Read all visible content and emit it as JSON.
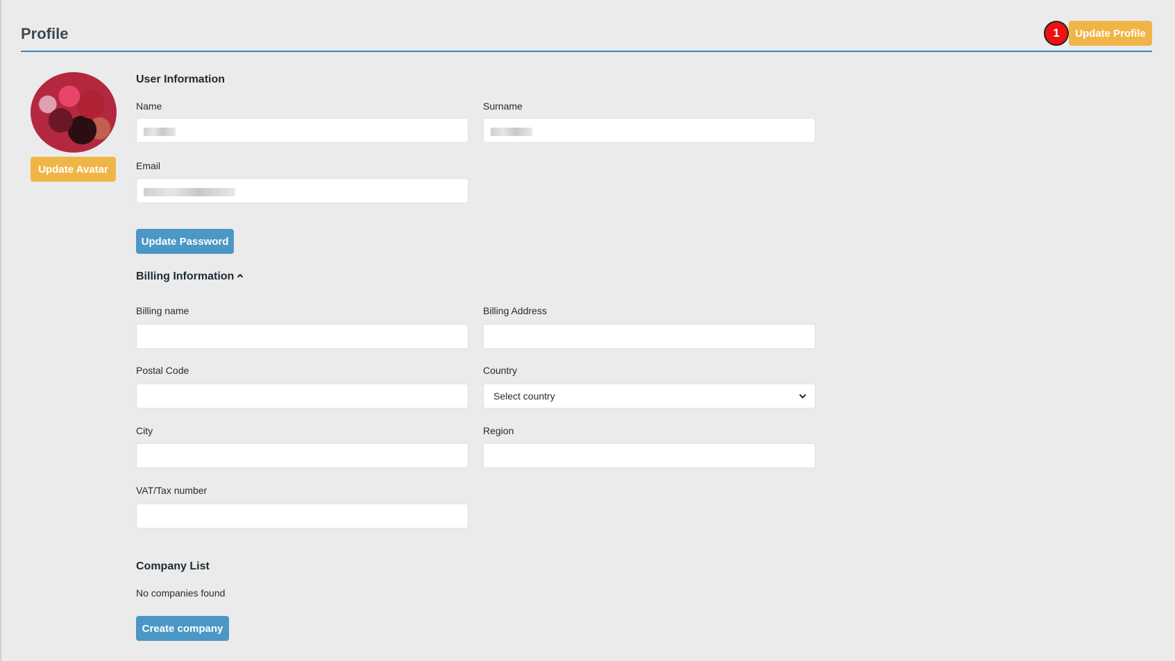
{
  "header": {
    "title": "Profile",
    "step_badge": "1",
    "update_profile_label": "Update Profile"
  },
  "avatar": {
    "update_label": "Update Avatar"
  },
  "user_info": {
    "heading": "User Information",
    "name_label": "Name",
    "surname_label": "Surname",
    "email_label": "Email",
    "update_password_label": "Update Password"
  },
  "billing": {
    "heading": "Billing Information",
    "billing_name_label": "Billing name",
    "billing_address_label": "Billing Address",
    "postal_code_label": "Postal Code",
    "country_label": "Country",
    "country_selected": "Select country",
    "city_label": "City",
    "region_label": "Region",
    "vat_label": "VAT/Tax number"
  },
  "company": {
    "heading": "Company List",
    "empty_text": "No companies found",
    "create_label": "Create company"
  },
  "colors": {
    "accent_yellow": "#f0b547",
    "accent_blue": "#4b97c5",
    "rule_blue": "#3a86c6",
    "badge_red": "#ee1111"
  }
}
